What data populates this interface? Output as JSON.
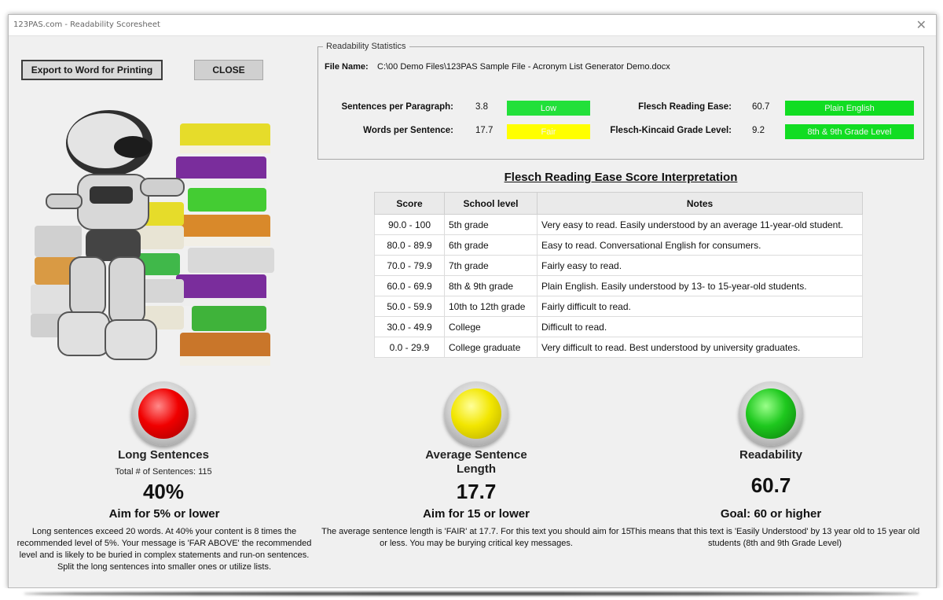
{
  "window": {
    "title": "123PAS.com - Readability Scoresheet",
    "close_glyph": "✕"
  },
  "buttons": {
    "export_label": "Export to Word for Printing",
    "close_label": "CLOSE"
  },
  "stats": {
    "legend": "Readability Statistics",
    "file_label": "File Name:",
    "file_value": "C:\\00 Demo Files\\123PAS Sample File - Acronym List Generator Demo.docx",
    "rows": [
      {
        "label": "Sentences per Paragraph:",
        "value": "3.8",
        "badge": "Low",
        "badge_color": "#22e03a"
      },
      {
        "label": "Words per Sentence:",
        "value": "17.7",
        "badge": "Fair",
        "badge_color": "#ffff00"
      },
      {
        "label": "Flesch Reading Ease:",
        "value": "60.7",
        "badge": "Plain English",
        "badge_color": "#11dd22"
      },
      {
        "label": "Flesch-Kincaid Grade Level:",
        "value": "9.2",
        "badge": "8th & 9th Grade Level",
        "badge_color": "#11dd22"
      }
    ]
  },
  "interpretation": {
    "title": "Flesch Reading Ease Score Interpretation",
    "headers": [
      "Score",
      "School level",
      "Notes"
    ],
    "rows": [
      [
        "90.0 - 100",
        "5th grade",
        "Very easy to read. Easily understood by an average 11-year-old student."
      ],
      [
        "80.0 - 89.9",
        "6th grade",
        "Easy to read. Conversational English for consumers."
      ],
      [
        "70.0 - 79.9",
        "7th grade",
        "Fairly easy to read."
      ],
      [
        "60.0 - 69.9",
        "8th & 9th grade",
        "Plain English. Easily understood by 13- to 15-year-old students."
      ],
      [
        "50.0 - 59.9",
        "10th to 12th grade",
        "Fairly difficult to read."
      ],
      [
        "30.0 - 49.9",
        "College",
        "Difficult to read."
      ],
      [
        "0.0 - 29.9",
        "College graduate",
        "Very difficult to read. Best understood by university graduates."
      ]
    ]
  },
  "gauges": {
    "long": {
      "light_color": "red",
      "title": "Long Sentences",
      "subtitle": "Total # of Sentences: 115",
      "big": "40%",
      "aim": "Aim for 5% or lower",
      "desc": "Long sentences exceed 20 words. At 40% your content is 8 times the recommended level of 5%. Your message is 'FAR ABOVE' the recommended level and is likely to be buried in complex statements and run-on sentences. Split the long sentences into smaller ones or utilize lists."
    },
    "average": {
      "light_color": "yellow",
      "title": "Average Sentence Length",
      "big": "17.7",
      "aim": "Aim for 15 or lower",
      "desc": "The average sentence length is 'FAIR' at 17.7. For this text you should aim for 15 or less. You may be burying critical key messages."
    },
    "readability": {
      "light_color": "green",
      "title": "Readability",
      "big": "60.7",
      "aim": "Goal: 60 or higher",
      "desc": "This means that this text is 'Easily Understood' by 13 year old to 15 year old students (8th and 9th Grade Level)"
    }
  }
}
